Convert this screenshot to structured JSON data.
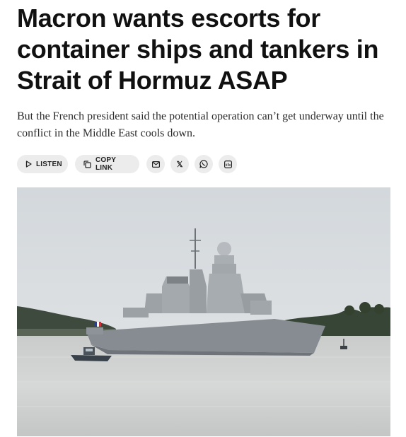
{
  "article": {
    "headline": "Macron wants escorts for container ships and tankers in Strait of Hormuz ASAP",
    "dek": "But the French president said the potential operation can’t get underway until the conflict in the Middle East cools down."
  },
  "share_bar": {
    "listen_label": "LISTEN",
    "copy_link_label": "COPY LINK",
    "x_label": "𝕏",
    "icons": [
      "play-icon",
      "copy-icon",
      "email-icon",
      "x-icon",
      "whatsapp-icon",
      "more-share-icon"
    ]
  },
  "photo": {
    "subject": "warship-at-sea",
    "colors": {
      "sky": "#d9dde0",
      "sea": "#cfd2d1",
      "hull": "#8b9096",
      "hills": "#3d4a3c"
    }
  }
}
